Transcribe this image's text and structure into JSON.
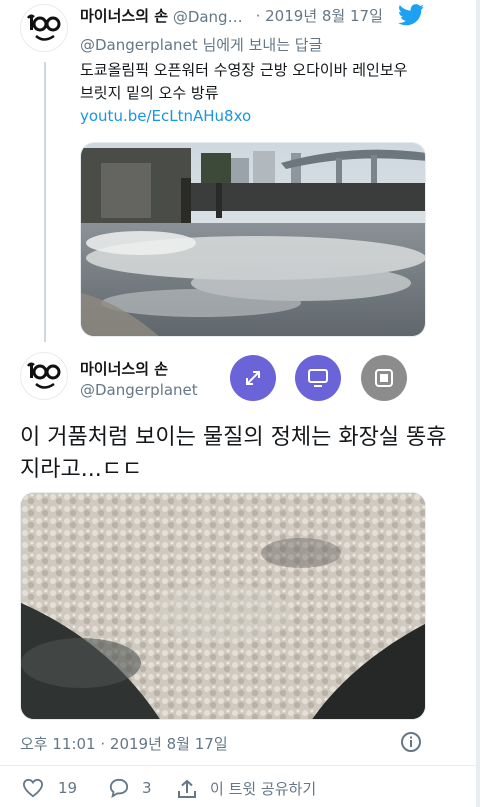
{
  "reply_tweet": {
    "author_name": "마이너스의 손",
    "author_handle": "@Dangerplanet",
    "date": "2019년 8월 17일",
    "replying_to_handle": "@Dangerplanet",
    "replying_to_suffix": " 님에게 보내는 답글",
    "text": "도쿄올림픽 오픈워터 수영장 근방 오다이바 레인보우 브릿지 밑의 오수 방류",
    "link": "youtu.be/EcLtnAHu8xo"
  },
  "main_tweet": {
    "author_name": "마이너스의 손",
    "author_handle": "@Dangerplanet",
    "text": "이 거품처럼 보이는 물질의 정체는 화장실 똥휴지라고...ㄷㄷ",
    "timestamp": "오후 11:01 · 2019년 8월 17일",
    "likes": "19",
    "replies": "3",
    "share_label": "이 트윗 공유하기"
  },
  "colors": {
    "twitter_blue": "#1da1f2",
    "fab_purple": "#6b63d8",
    "fab_grey": "#8c8c8c"
  },
  "icons": [
    "twitter-bird-icon",
    "expand-icon",
    "screen-icon",
    "pip-icon",
    "heart-icon",
    "reply-icon",
    "share-icon",
    "info-icon"
  ]
}
